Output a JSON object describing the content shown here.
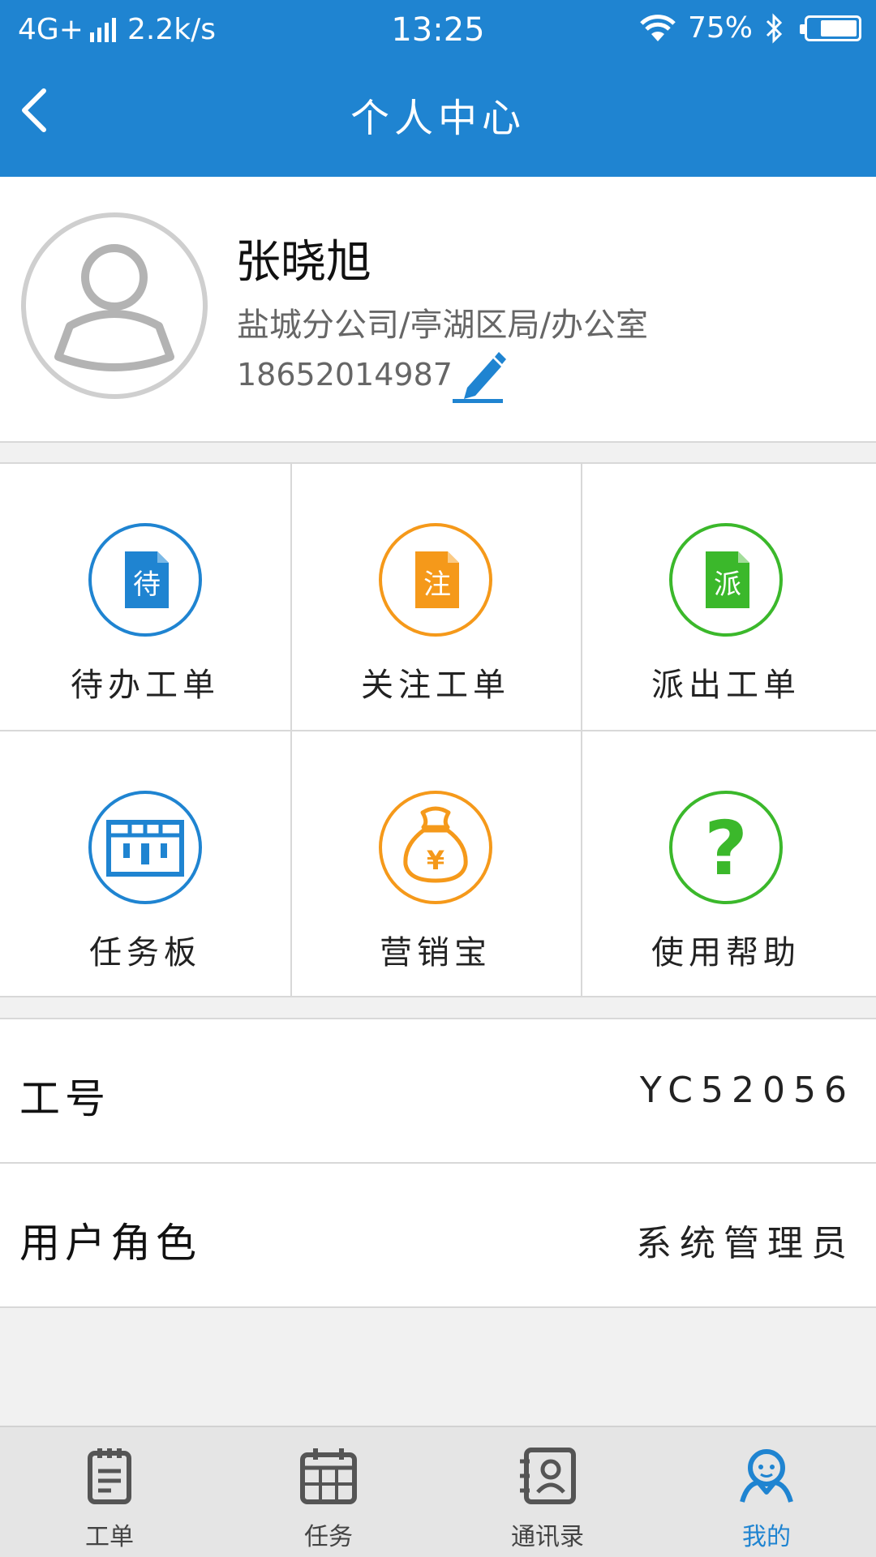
{
  "status_bar": {
    "network": "4G+",
    "speed": "2.2k/s",
    "time": "13:25",
    "battery": "75%",
    "battery_level": 0.75
  },
  "header": {
    "title": "个人中心",
    "back_icon": "chevron-left-icon"
  },
  "profile": {
    "name": "张晓旭",
    "department": "盐城分公司/亭湖区局/办公室",
    "phone": "18652014987",
    "edit_icon": "pencil-icon"
  },
  "grid": {
    "items": [
      {
        "label": "待办工单",
        "glyph": "待",
        "color": "#1f84d1",
        "icon": "pending-order-icon"
      },
      {
        "label": "关注工单",
        "glyph": "注",
        "color": "#f5991a",
        "icon": "followed-order-icon"
      },
      {
        "label": "派出工单",
        "glyph": "派",
        "color": "#3bb82b",
        "icon": "dispatched-order-icon"
      },
      {
        "label": "任务板",
        "color": "#1f84d1",
        "icon": "task-board-icon"
      },
      {
        "label": "营销宝",
        "glyph": "¥",
        "color": "#f5991a",
        "icon": "money-bag-icon"
      },
      {
        "label": "使用帮助",
        "glyph": "?",
        "color": "#3bb82b",
        "icon": "question-icon"
      }
    ]
  },
  "info": {
    "employee_id_label": "工号",
    "employee_id": "YC52056",
    "role_label": "用户角色",
    "role": "系统管理员"
  },
  "tabs": [
    {
      "label": "工单",
      "icon": "clipboard-icon"
    },
    {
      "label": "任务",
      "icon": "calendar-icon"
    },
    {
      "label": "通讯录",
      "icon": "contacts-icon"
    },
    {
      "label": "我的",
      "icon": "user-icon",
      "active": true
    }
  ],
  "colors": {
    "primary": "#1f84d1",
    "orange": "#f5991a",
    "green": "#3bb82b"
  }
}
